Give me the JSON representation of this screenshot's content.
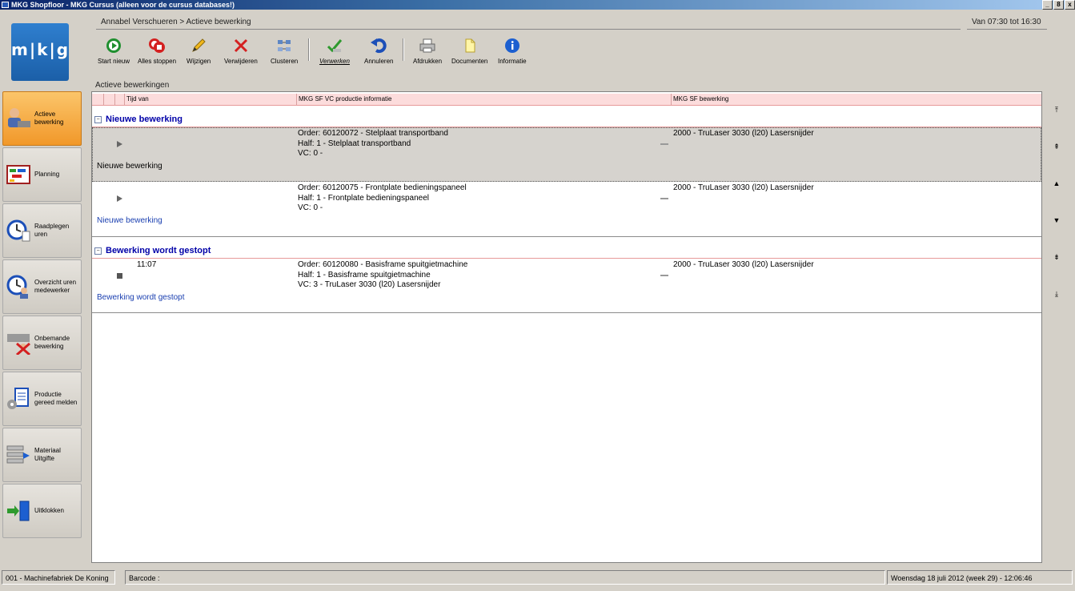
{
  "window": {
    "title": "MKG Shopfloor - MKG Cursus (alleen voor de cursus databases!)",
    "controls": [
      "_",
      "8",
      "x"
    ]
  },
  "logo": {
    "text": "m|k|g"
  },
  "header": {
    "breadcrumb": "Annabel Verschueren > Actieve bewerking",
    "time_range": "Van 07:30 tot 16:30"
  },
  "toolbar": {
    "start_nieuw": "Start nieuw",
    "alles_stoppen": "Alles stoppen",
    "wijzigen": "Wijzigen",
    "verwijderen": "Verwijderen",
    "clusteren": "Clusteren",
    "verwerken": "Verwerken",
    "annuleren": "Annuleren",
    "afdrukken": "Afdrukken",
    "documenten": "Documenten",
    "informatie": "Informatie"
  },
  "section_label": "Actieve bewerkingen",
  "sidebar": {
    "items": [
      {
        "label": "Actieve bewerking",
        "icon": "worker-icon",
        "active": true
      },
      {
        "label": "Planning",
        "icon": "planning-board-icon",
        "active": false
      },
      {
        "label": "Raadplegen uren",
        "icon": "clock-icon",
        "active": false
      },
      {
        "label": "Overzicht uren medewerker",
        "icon": "clock-person-icon",
        "active": false
      },
      {
        "label": "Onbemande bewerking",
        "icon": "unmanned-machine-icon",
        "active": false
      },
      {
        "label": "Productie gereed melden",
        "icon": "production-report-icon",
        "active": false
      },
      {
        "label": "Materiaal Uitgifte",
        "icon": "material-shelf-icon",
        "active": false
      },
      {
        "label": "Uitklokken",
        "icon": "clock-out-icon",
        "active": false
      }
    ]
  },
  "grid": {
    "columns": [
      "Tijd van",
      "MKG SF VC productie informatie",
      "MKG SF bewerking"
    ],
    "groups": [
      {
        "title": "Nieuwe bewerking",
        "rows": [
          {
            "time": "",
            "status": "play",
            "info": [
              "Order: 60120072 - Stelplaat transportband",
              "Half: 1 - Stelplaat transportband",
              "VC: 0 -"
            ],
            "bewerking": "2000 - TruLaser 3030 (l20) Lasersnijder",
            "subtitle": "Nieuwe bewerking",
            "selected": true
          },
          {
            "time": "",
            "status": "play",
            "info": [
              "Order: 60120075 - Frontplate bedieningspaneel",
              "Half: 1 - Frontplate bedieningspaneel",
              "VC: 0 -"
            ],
            "bewerking": "2000 - TruLaser 3030 (l20) Lasersnijder",
            "subtitle": "Nieuwe bewerking",
            "selected": false
          }
        ]
      },
      {
        "title": "Bewerking wordt gestopt",
        "rows": [
          {
            "time": "11:07",
            "status": "stop",
            "info": [
              "Order: 60120080 - Basisframe spuitgietmachine",
              "Half: 1 - Basisframe spuitgietmachine",
              "VC: 3 - TruLaser 3030 (l20) Lasersnijder"
            ],
            "bewerking": "2000 - TruLaser 3030 (l20) Lasersnijder",
            "subtitle": "Bewerking wordt gestopt",
            "selected": false
          }
        ]
      }
    ]
  },
  "nav": [
    "⤒",
    "⇞",
    "▲",
    "▼",
    "⇟",
    "⤓"
  ],
  "statusbar": {
    "company": "001 - Machinefabriek De Koning",
    "barcode_label": "Barcode :",
    "datetime": "Woensdag 18 juli 2012 (week 29) - 12:06:46"
  },
  "colors": {
    "accent_orange": "#f1982a",
    "group_title": "#0000a8",
    "header_bg": "#fcdcdc",
    "subtitle_link": "#1a3fb0"
  }
}
